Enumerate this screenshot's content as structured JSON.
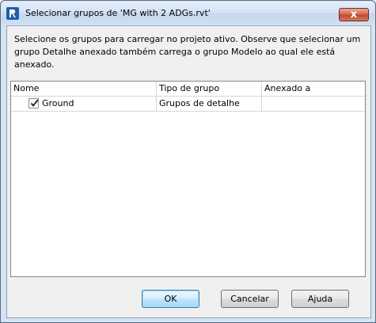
{
  "window": {
    "title": "Selecionar grupos de 'MG with 2 ADGs.rvt'",
    "close_glyph": "x",
    "app_icon": "revit-logo-icon"
  },
  "instructions": "Selecione os grupos para carregar no projeto ativo.  Observe que selecionar um grupo Detalhe anexado também carrega o grupo Modelo ao qual ele está anexado.",
  "table": {
    "columns": [
      "Nome",
      "Tipo de grupo",
      "Anexado a"
    ],
    "rows": [
      {
        "checked": true,
        "name": "Ground",
        "type": "Grupos de detalhe",
        "attached_to": ""
      }
    ]
  },
  "buttons": {
    "ok": "OK",
    "cancel": "Cancelar",
    "help": "Ajuda"
  },
  "colors": {
    "titlebar": "#d3e2f4",
    "close_button": "#c04a31",
    "default_button_border": "#3c7fb1",
    "client_background": "#f0f0f0"
  }
}
